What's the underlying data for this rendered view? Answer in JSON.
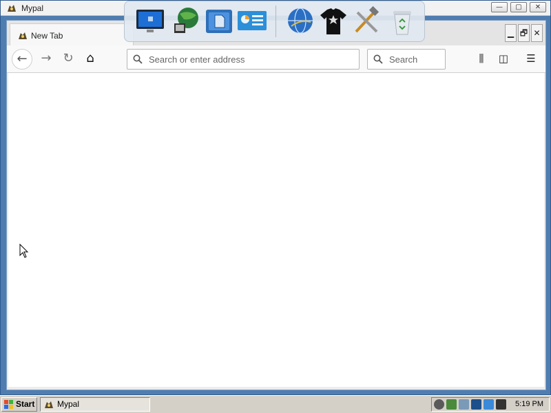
{
  "window": {
    "title": "Mypal",
    "controls": [
      "minimize-icon",
      "restore-icon",
      "close-icon"
    ],
    "control_glyphs": [
      "—",
      "▢",
      "✕"
    ]
  },
  "browser": {
    "tab_label": "New Tab",
    "frame_controls": [
      "minimize-icon",
      "restore-icon",
      "close-icon"
    ],
    "frame_control_glyphs": [
      "▁",
      "🗗",
      "✕"
    ],
    "nav": {
      "back_glyph": "←",
      "forward_glyph": "→",
      "reload_glyph": "↻",
      "home_glyph": "⌂"
    },
    "url_placeholder": "Search or enter address",
    "search_placeholder": "Search",
    "right": {
      "library_glyph": "⫼",
      "sidebar_glyph": "◫",
      "menu_glyph": "☰"
    }
  },
  "dock": {
    "items": [
      "desktop-icon",
      "network-icon",
      "documents-icon",
      "control-panel-icon",
      "internet-globe-icon",
      "tshirt-icon",
      "tools-icon",
      "recycle-bin-icon"
    ]
  },
  "taskbar": {
    "start_label": "Start",
    "task_label": "Mypal",
    "clock": "5:19 PM",
    "tray_icons": [
      "tray-disk-icon",
      "tray-monitor-icon",
      "tray-volume-icon",
      "tray-network-icon",
      "tray-chart-icon",
      "tray-app-icon"
    ]
  },
  "colors": {
    "desktop": "#3a6ea5",
    "window_border": "#4f7db0",
    "content": "#ffffff",
    "taskbar": "#d4d0c8"
  }
}
